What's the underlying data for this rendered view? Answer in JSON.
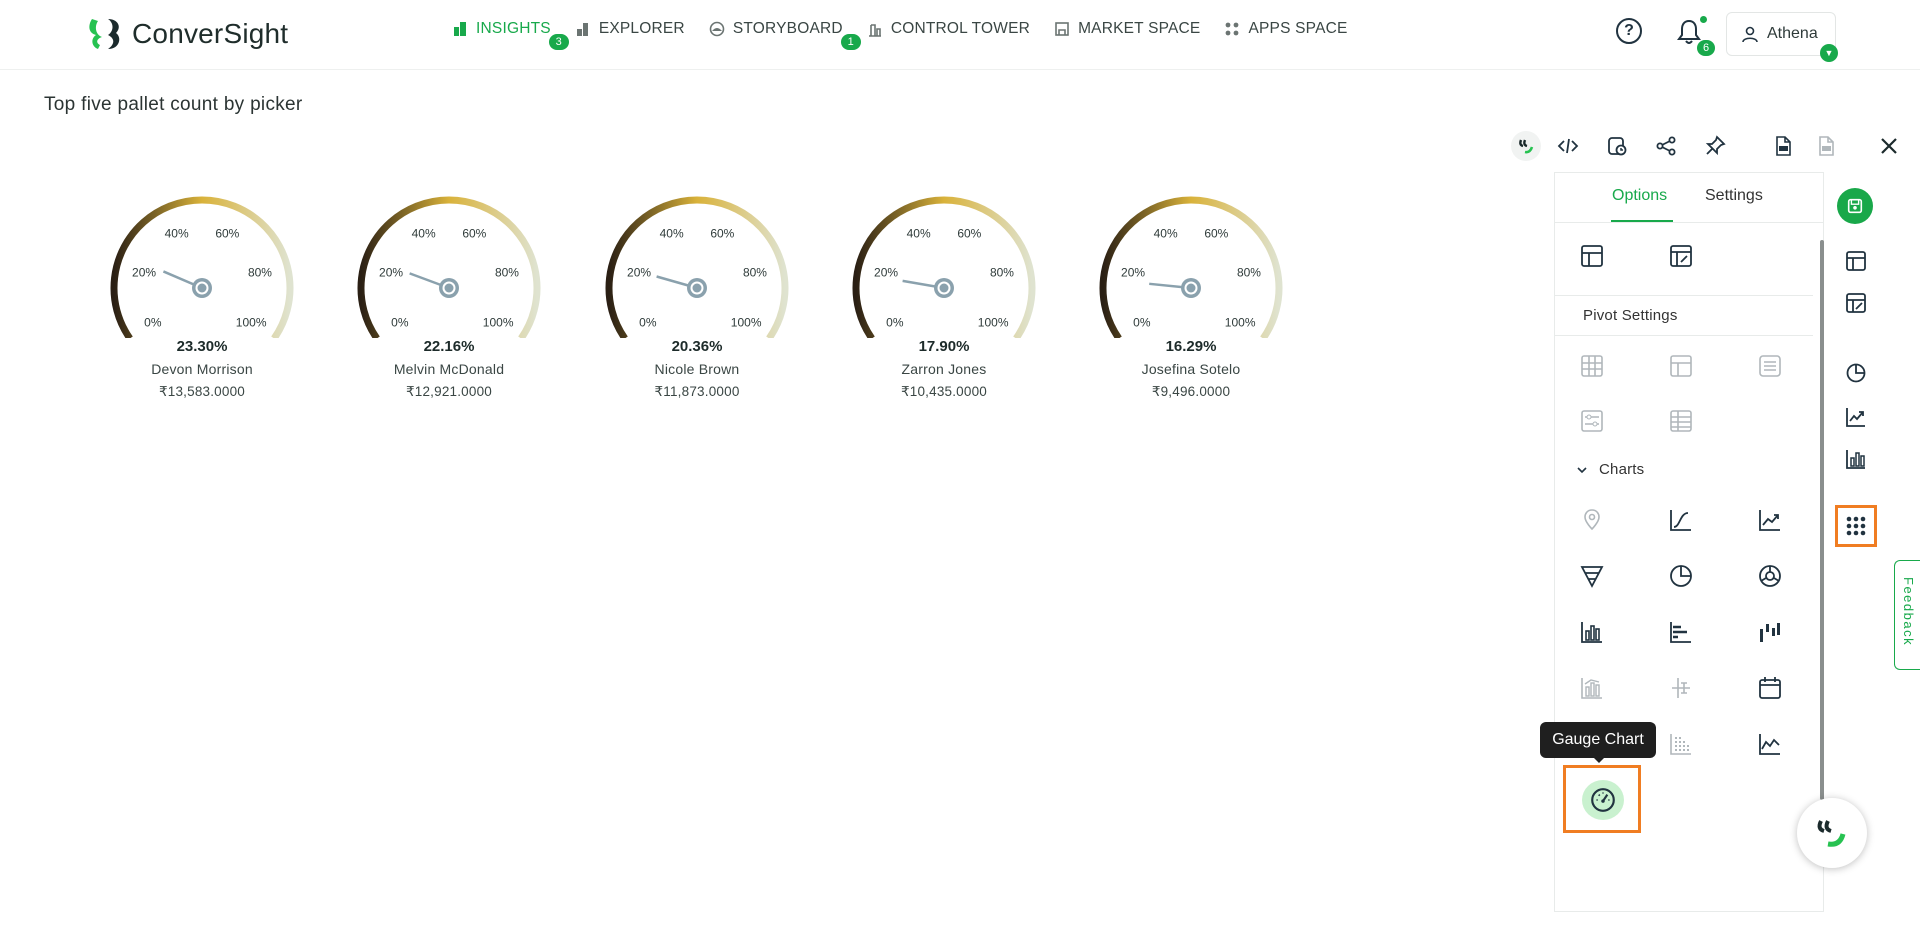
{
  "app": {
    "logo_text": "ConverSight"
  },
  "nav": [
    {
      "label": "INSIGHTS",
      "icon": "bar-chart-icon",
      "active": true,
      "badge": "3"
    },
    {
      "label": "EXPLORER",
      "icon": "bar-chart-icon",
      "active": false,
      "badge": ""
    },
    {
      "label": "STORYBOARD",
      "icon": "storyboard-icon",
      "active": false,
      "badge": "1"
    },
    {
      "label": "CONTROL TOWER",
      "icon": "tower-icon",
      "active": false,
      "badge": ""
    },
    {
      "label": "MARKET SPACE",
      "icon": "store-icon",
      "active": false,
      "badge": ""
    },
    {
      "label": "APPS SPACE",
      "icon": "grid-icon",
      "active": false,
      "badge": ""
    }
  ],
  "header": {
    "help": "?",
    "notification_count": "6",
    "user_name": "Athena"
  },
  "page": {
    "title": "Top five pallet count by picker"
  },
  "chart_data": {
    "type": "gauge",
    "tick_labels": [
      "0%",
      "20%",
      "40%",
      "60%",
      "80%",
      "100%"
    ],
    "gauges": [
      {
        "percent_label": "23.30%",
        "percent": 23.3,
        "name": "Devon Morrison",
        "value_label": "₹13,583.0000"
      },
      {
        "percent_label": "22.16%",
        "percent": 22.16,
        "name": "Melvin McDonald",
        "value_label": "₹12,921.0000"
      },
      {
        "percent_label": "20.36%",
        "percent": 20.36,
        "name": "Nicole Brown",
        "value_label": "₹11,873.0000"
      },
      {
        "percent_label": "17.90%",
        "percent": 17.9,
        "name": "Zarron Jones",
        "value_label": "₹10,435.0000"
      },
      {
        "percent_label": "16.29%",
        "percent": 16.29,
        "name": "Josefina Sotelo",
        "value_label": "₹9,496.0000"
      }
    ],
    "colors": {
      "arc_start": "#2a1f14",
      "arc_mid": "#d9b23a",
      "arc_end": "#dfe3d0",
      "needle": "#8aa1ad"
    }
  },
  "panel": {
    "tabs": [
      "Options",
      "Settings"
    ],
    "active_tab": "Options",
    "pivot_label": "Pivot Settings",
    "charts_label": "Charts",
    "tooltip": "Gauge Chart"
  },
  "colors": {
    "brand": "#18a94b",
    "highlight": "#f07d22"
  },
  "feedback": {
    "label": "Feedback"
  }
}
